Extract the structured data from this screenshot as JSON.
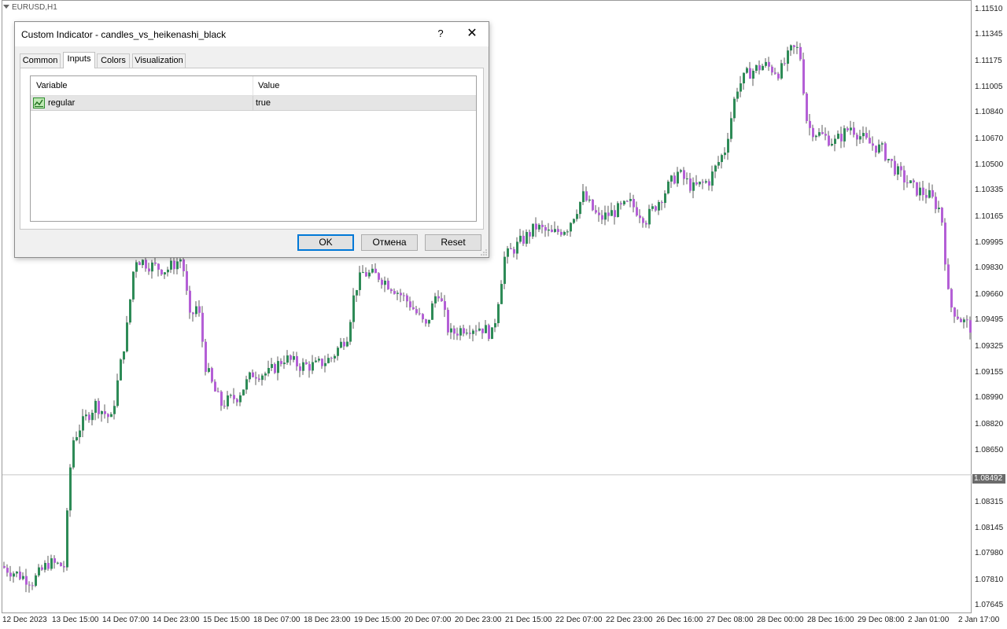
{
  "chart": {
    "symbol_label": "EURUSD,H1",
    "current_price": "1.08492",
    "price_ticks": [
      "1.11510",
      "1.11345",
      "1.11175",
      "1.11005",
      "1.10840",
      "1.10670",
      "1.10500",
      "1.10335",
      "1.10165",
      "1.09995",
      "1.09830",
      "1.09660",
      "1.09495",
      "1.09325",
      "1.09155",
      "1.08990",
      "1.08820",
      "1.08650",
      "1.08315",
      "1.08145",
      "1.07980",
      "1.07810",
      "1.07645"
    ],
    "time_ticks": [
      "12 Dec 2023",
      "13 Dec 15:00",
      "14 Dec 07:00",
      "14 Dec 23:00",
      "15 Dec 15:00",
      "18 Dec 07:00",
      "18 Dec 23:00",
      "19 Dec 15:00",
      "20 Dec 07:00",
      "20 Dec 23:00",
      "21 Dec 15:00",
      "22 Dec 07:00",
      "22 Dec 23:00",
      "26 Dec 16:00",
      "27 Dec 08:00",
      "28 Dec 00:00",
      "28 Dec 16:00",
      "29 Dec 08:00",
      "2 Jan 01:00",
      "2 Jan 17:00"
    ],
    "colors": {
      "bull": "#2e8b57",
      "bear": "#b45fd6",
      "wick": "#333333",
      "grid": "#dcdcdc",
      "axis": "#9a9a9a"
    }
  },
  "chart_data": {
    "type": "candlestick",
    "symbol": "EURUSD",
    "timeframe": "H1",
    "ylim": [
      1.07645,
      1.1151
    ],
    "current_price": 1.08492,
    "close_path": [
      [
        0,
        1.079
      ],
      [
        20,
        1.0785
      ],
      [
        40,
        1.078
      ],
      [
        60,
        1.0792
      ],
      [
        80,
        1.079
      ],
      [
        90,
        1.087
      ],
      [
        100,
        1.088
      ],
      [
        120,
        1.0895
      ],
      [
        140,
        1.0885
      ],
      [
        160,
        1.0945
      ],
      [
        170,
        1.099
      ],
      [
        190,
        1.0985
      ],
      [
        210,
        1.0982
      ],
      [
        230,
        1.099
      ],
      [
        240,
        1.095
      ],
      [
        250,
        1.096
      ],
      [
        260,
        1.092
      ],
      [
        270,
        1.0905
      ],
      [
        280,
        1.0895
      ],
      [
        300,
        1.09
      ],
      [
        320,
        1.0915
      ],
      [
        340,
        1.0915
      ],
      [
        360,
        1.0925
      ],
      [
        380,
        1.092
      ],
      [
        400,
        1.092
      ],
      [
        420,
        1.0925
      ],
      [
        440,
        1.094
      ],
      [
        450,
        1.097
      ],
      [
        460,
        1.098
      ],
      [
        480,
        1.0978
      ],
      [
        500,
        1.097
      ],
      [
        520,
        1.096
      ],
      [
        540,
        1.0945
      ],
      [
        555,
        1.097
      ],
      [
        570,
        1.094
      ],
      [
        590,
        1.0945
      ],
      [
        610,
        1.0945
      ],
      [
        625,
        1.094
      ],
      [
        640,
        1.099
      ],
      [
        660,
        1.1
      ],
      [
        680,
        1.101
      ],
      [
        700,
        1.1005
      ],
      [
        720,
        1.101
      ],
      [
        740,
        1.103
      ],
      [
        760,
        1.1015
      ],
      [
        780,
        1.102
      ],
      [
        800,
        1.1025
      ],
      [
        820,
        1.1015
      ],
      [
        840,
        1.103
      ],
      [
        860,
        1.1045
      ],
      [
        880,
        1.1035
      ],
      [
        900,
        1.104
      ],
      [
        920,
        1.106
      ],
      [
        935,
        1.11
      ],
      [
        950,
        1.111
      ],
      [
        970,
        1.1115
      ],
      [
        990,
        1.111
      ],
      [
        1005,
        1.1125
      ],
      [
        1015,
        1.1125
      ],
      [
        1025,
        1.1075
      ],
      [
        1040,
        1.107
      ],
      [
        1060,
        1.1065
      ],
      [
        1080,
        1.1075
      ],
      [
        1100,
        1.1065
      ],
      [
        1120,
        1.106
      ],
      [
        1140,
        1.1045
      ],
      [
        1160,
        1.1035
      ],
      [
        1180,
        1.103
      ],
      [
        1195,
        1.102
      ],
      [
        1205,
        1.096
      ],
      [
        1220,
        1.095
      ],
      [
        1232,
        1.0945
      ]
    ],
    "bull_color": "#2e8b57",
    "bear_color": "#b45fd6"
  },
  "dialog": {
    "title": "Custom Indicator - candles_vs_heikenashi_black",
    "help_label": "?",
    "close_label": "✕",
    "tabs": [
      {
        "label": "Common"
      },
      {
        "label": "Inputs"
      },
      {
        "label": "Colors"
      },
      {
        "label": "Visualization"
      }
    ],
    "active_tab": "Inputs",
    "columns": {
      "variable": "Variable",
      "value": "Value"
    },
    "rows": [
      {
        "icon": "indicator-param-icon",
        "variable": "regular",
        "value": "true"
      }
    ],
    "buttons": {
      "ok": "OK",
      "cancel": "Отмена",
      "reset": "Reset"
    }
  }
}
